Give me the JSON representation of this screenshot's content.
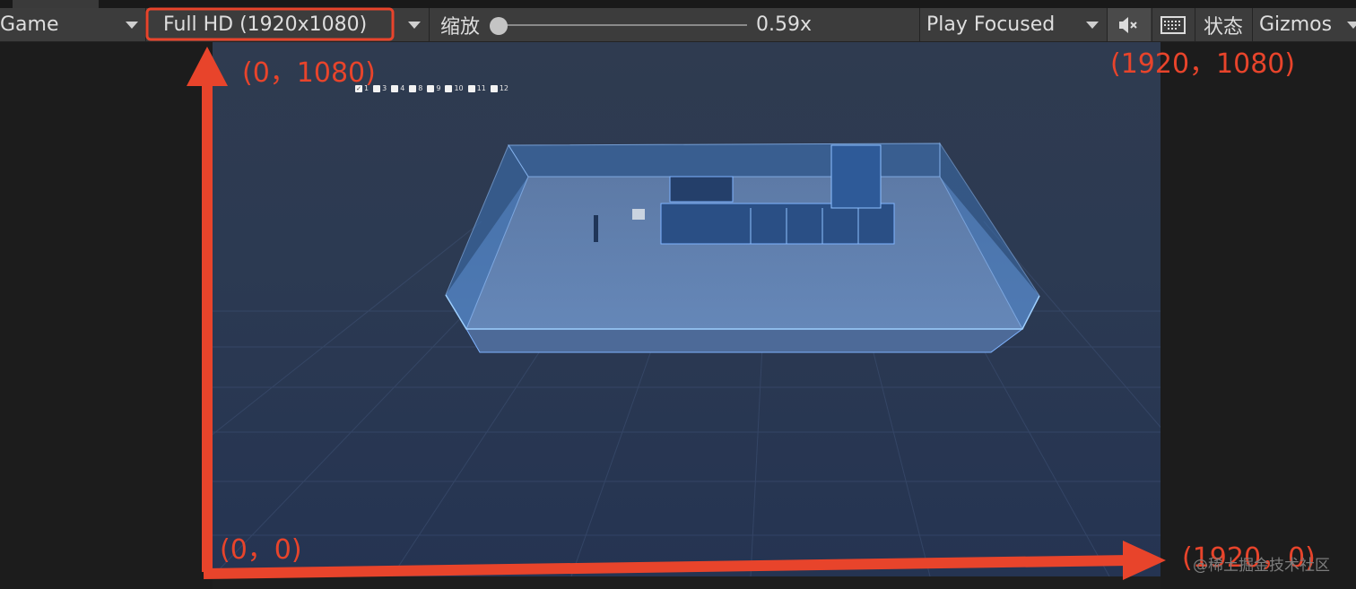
{
  "toolbar": {
    "view_select": "Game",
    "resolution": "Full HD (1920x1080)",
    "zoom_label": "缩放",
    "zoom_value": "0.59x",
    "zoom_fraction": 0.05,
    "play_mode": "Play Focused",
    "mute_icon": "audio-mute-icon",
    "keyboard_icon": "keyboard-icon",
    "stats_label": "状态",
    "gizmos_label": "Gizmos"
  },
  "floor_toggles": [
    {
      "label": "1",
      "checked": true
    },
    {
      "label": "3",
      "checked": false
    },
    {
      "label": "4",
      "checked": false
    },
    {
      "label": "8",
      "checked": false
    },
    {
      "label": "9",
      "checked": false
    },
    {
      "label": "10",
      "checked": false
    },
    {
      "label": "11",
      "checked": false
    },
    {
      "label": "12",
      "checked": false
    }
  ],
  "annotations": {
    "top_left": "(0，1080)",
    "top_right": "(1920，1080)",
    "bottom_left": "(0，0)",
    "bottom_right": "(1920，0)",
    "color": "#e8442b"
  },
  "watermark": "@稀土掘金技术社区"
}
